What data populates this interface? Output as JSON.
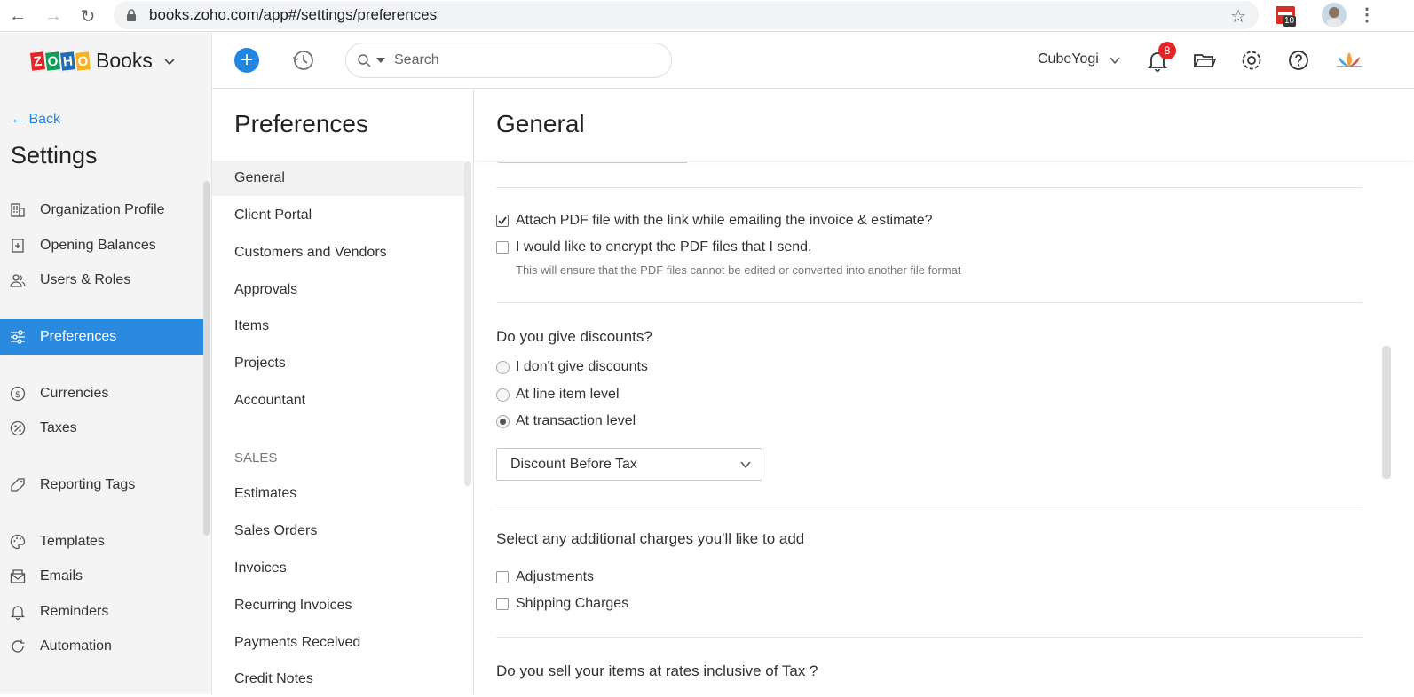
{
  "browser": {
    "url": "books.zoho.com/app#/settings/preferences",
    "extension_badge": "10"
  },
  "header": {
    "brand_logo_letters": [
      "Z",
      "O",
      "H",
      "O"
    ],
    "brand_name": "Books",
    "search_placeholder": "Search",
    "org_name": "CubeYogi",
    "notification_count": "8"
  },
  "sidebar": {
    "back_label": "Back",
    "title": "Settings",
    "items": [
      {
        "label": "Organization Profile"
      },
      {
        "label": "Opening Balances"
      },
      {
        "label": "Users & Roles"
      },
      {
        "label": "Preferences",
        "active": true
      },
      {
        "label": "Currencies"
      },
      {
        "label": "Taxes"
      },
      {
        "label": "Reporting Tags"
      },
      {
        "label": "Templates"
      },
      {
        "label": "Emails"
      },
      {
        "label": "Reminders"
      },
      {
        "label": "Automation"
      }
    ]
  },
  "preferences": {
    "title": "Preferences",
    "items": [
      {
        "label": "General",
        "active": true
      },
      {
        "label": "Client Portal"
      },
      {
        "label": "Customers and Vendors"
      },
      {
        "label": "Approvals"
      },
      {
        "label": "Items"
      },
      {
        "label": "Projects"
      },
      {
        "label": "Accountant"
      }
    ],
    "sales_section": "SALES",
    "sales_items": [
      {
        "label": "Estimates"
      },
      {
        "label": "Sales Orders"
      },
      {
        "label": "Invoices"
      },
      {
        "label": "Recurring Invoices"
      },
      {
        "label": "Payments Received"
      },
      {
        "label": "Credit Notes"
      }
    ]
  },
  "content": {
    "title": "General",
    "attach_pdf": {
      "label": "Attach PDF file with the link while emailing the invoice & estimate?",
      "checked": true
    },
    "encrypt_pdf": {
      "label": "I would like to encrypt the PDF files that I send.",
      "checked": false
    },
    "encrypt_hint": "This will ensure that the PDF files cannot be edited or converted into another file format",
    "discount_question": "Do you give discounts?",
    "discount_options": [
      {
        "label": "I don't give discounts",
        "selected": false
      },
      {
        "label": "At line item level",
        "selected": false
      },
      {
        "label": "At transaction level",
        "selected": true
      }
    ],
    "discount_type_value": "Discount Before Tax",
    "charges_question": "Select any additional charges you'll like to add",
    "charges": [
      {
        "label": "Adjustments",
        "checked": false
      },
      {
        "label": "Shipping Charges",
        "checked": false
      }
    ],
    "tax_question": "Do you sell your items at rates inclusive of Tax ?"
  },
  "colors": {
    "accent": "#2186e2",
    "active_sidebar": "#2a8ae0",
    "badge_red": "#e42527"
  }
}
